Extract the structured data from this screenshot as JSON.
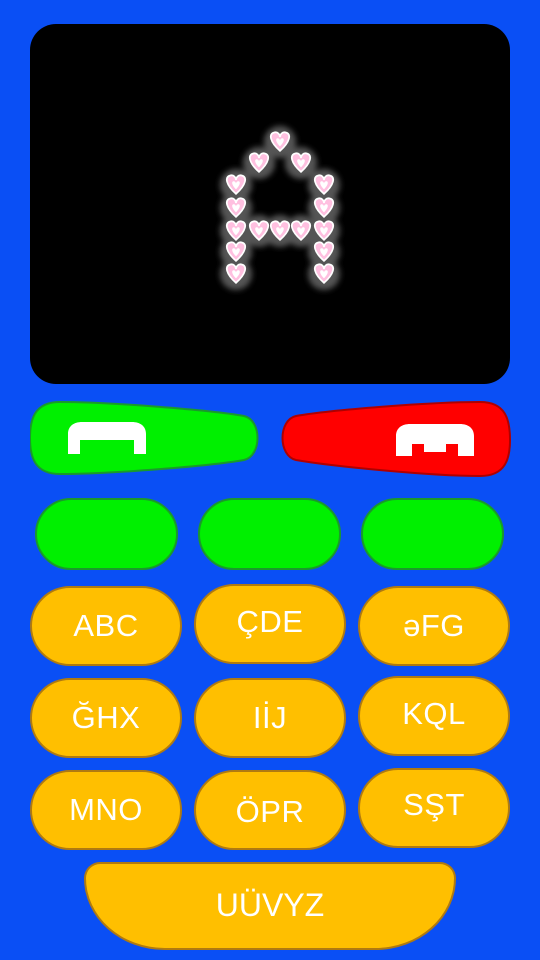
{
  "display": {
    "glyph": "A",
    "glyph_style": "heart-dots",
    "heart_color": "#ffc0e0",
    "heart_outline": "#ffffff",
    "glow_color": "#555555"
  },
  "call": {
    "accept_color": "#00f000",
    "end_color": "#ff0000",
    "accept_icon": "phone-handset-icon",
    "end_icon": "phone-hangup-icon"
  },
  "soft_keys": {
    "color": "#00f000",
    "count": 3
  },
  "keypad": {
    "key_color": "#ffbf00",
    "keys": [
      {
        "label": "ABC"
      },
      {
        "label": "ÇDE"
      },
      {
        "label": "əFG"
      },
      {
        "label": "ĞHX"
      },
      {
        "label": "IİJ"
      },
      {
        "label": "KQL"
      },
      {
        "label": "MNO"
      },
      {
        "label": "ÖPR"
      },
      {
        "label": "SŞT"
      }
    ],
    "bottom_key": {
      "label": "UÜVYZ"
    }
  }
}
